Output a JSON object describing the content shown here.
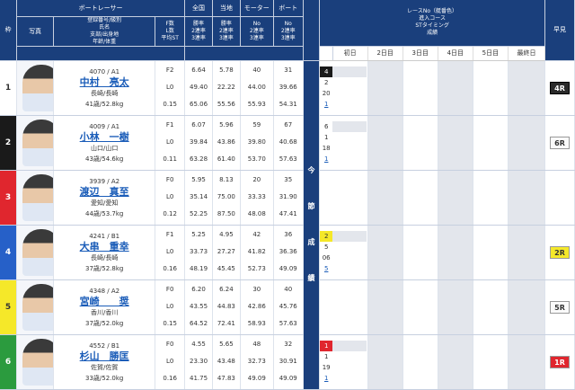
{
  "header": {
    "waku": "枠",
    "boat_racer": "ボートレーサー",
    "photo": "写真",
    "reg": "登録番号/級別",
    "name": "氏名",
    "branch": "支部/出身地",
    "age": "年齢/体重",
    "flst": "F数",
    "lst": "L数",
    "avgst": "平均ST",
    "national": "全国",
    "local": "当地",
    "motor": "モーター",
    "boat": "ボート",
    "win": "勝率",
    "r2": "2連率",
    "r3": "3連率",
    "no": "No",
    "r2b": "2連率",
    "r3b": "3連率",
    "race_no": "レースNo（艇番色）",
    "entry_course": "進入コース",
    "st_timing": "STタイミング",
    "result": "成績",
    "early": "早見",
    "days": [
      "初日",
      "2日目",
      "3日目",
      "4日目",
      "5日目",
      "最終日"
    ],
    "pillar": "今節成績"
  },
  "rows": [
    {
      "waku": "1",
      "reg": "4070 / A1",
      "name": "中村　亮太",
      "branch": "長崎/長崎",
      "age": "41歳/52.8kg",
      "f": "F2",
      "l": "L0",
      "st": "0.15",
      "nat": [
        "6.64",
        "49.40",
        "65.06"
      ],
      "loc": [
        "5.78",
        "22.22",
        "55.56"
      ],
      "mot": [
        "40",
        "44.00",
        "55.93"
      ],
      "boa": [
        "31",
        "39.66",
        "54.31"
      ],
      "day1": [
        "4",
        "2",
        "20",
        "1"
      ],
      "day1_color": "black",
      "early": "4R",
      "early_color": "black"
    },
    {
      "waku": "2",
      "reg": "4009 / A1",
      "name": "小林　一樹",
      "branch": "山口/山口",
      "age": "43歳/54.6kg",
      "f": "F1",
      "l": "L0",
      "st": "0.11",
      "nat": [
        "6.07",
        "39.84",
        "63.28"
      ],
      "loc": [
        "5.96",
        "43.86",
        "61.40"
      ],
      "mot": [
        "59",
        "39.80",
        "53.70"
      ],
      "boa": [
        "67",
        "40.68",
        "57.63"
      ],
      "day1": [
        "6",
        "1",
        "18",
        "1"
      ],
      "day1_color": "white",
      "early": "6R",
      "early_color": "white"
    },
    {
      "waku": "3",
      "reg": "3939 / A2",
      "name": "渡辺　真至",
      "branch": "愛知/愛知",
      "age": "44歳/53.7kg",
      "f": "F0",
      "l": "L0",
      "st": "0.12",
      "nat": [
        "5.95",
        "35.14",
        "52.25"
      ],
      "loc": [
        "8.13",
        "75.00",
        "87.50"
      ],
      "mot": [
        "20",
        "33.33",
        "48.08"
      ],
      "boa": [
        "35",
        "31.90",
        "47.41"
      ],
      "day1": [
        "",
        "",
        "",
        ""
      ],
      "day1_color": "none",
      "early": "",
      "early_color": "none"
    },
    {
      "waku": "4",
      "reg": "4241 / B1",
      "name": "大串　重幸",
      "branch": "長崎/長崎",
      "age": "37歳/52.8kg",
      "f": "F1",
      "l": "L0",
      "st": "0.16",
      "nat": [
        "5.25",
        "33.73",
        "48.19"
      ],
      "loc": [
        "4.95",
        "27.27",
        "45.45"
      ],
      "mot": [
        "42",
        "41.82",
        "52.73"
      ],
      "boa": [
        "36",
        "36.36",
        "49.09"
      ],
      "day1": [
        "2",
        "5",
        "06",
        "5"
      ],
      "day1_color": "yellow",
      "early": "2R",
      "early_color": "yellow"
    },
    {
      "waku": "5",
      "reg": "4348 / A2",
      "name": "宮崎　　奨",
      "branch": "香川/香川",
      "age": "37歳/52.0kg",
      "f": "F0",
      "l": "L0",
      "st": "0.15",
      "nat": [
        "6.20",
        "43.55",
        "64.52"
      ],
      "loc": [
        "6.24",
        "44.83",
        "72.41"
      ],
      "mot": [
        "30",
        "42.86",
        "58.93"
      ],
      "boa": [
        "40",
        "45.76",
        "57.63"
      ],
      "day1": [
        "",
        "",
        "",
        ""
      ],
      "day1_color": "none",
      "early": "5R",
      "early_color": "white"
    },
    {
      "waku": "6",
      "reg": "4552 / B1",
      "name": "杉山　勝匡",
      "branch": "佐賀/佐賀",
      "age": "33歳/52.0kg",
      "f": "F0",
      "l": "L0",
      "st": "0.16",
      "nat": [
        "4.55",
        "23.30",
        "41.75"
      ],
      "loc": [
        "5.65",
        "43.48",
        "47.83"
      ],
      "mot": [
        "48",
        "32.73",
        "49.09"
      ],
      "boa": [
        "32",
        "30.91",
        "49.09"
      ],
      "day1": [
        "1",
        "1",
        "19",
        "1"
      ],
      "day1_color": "red",
      "early": "1R",
      "early_color": "red"
    }
  ]
}
